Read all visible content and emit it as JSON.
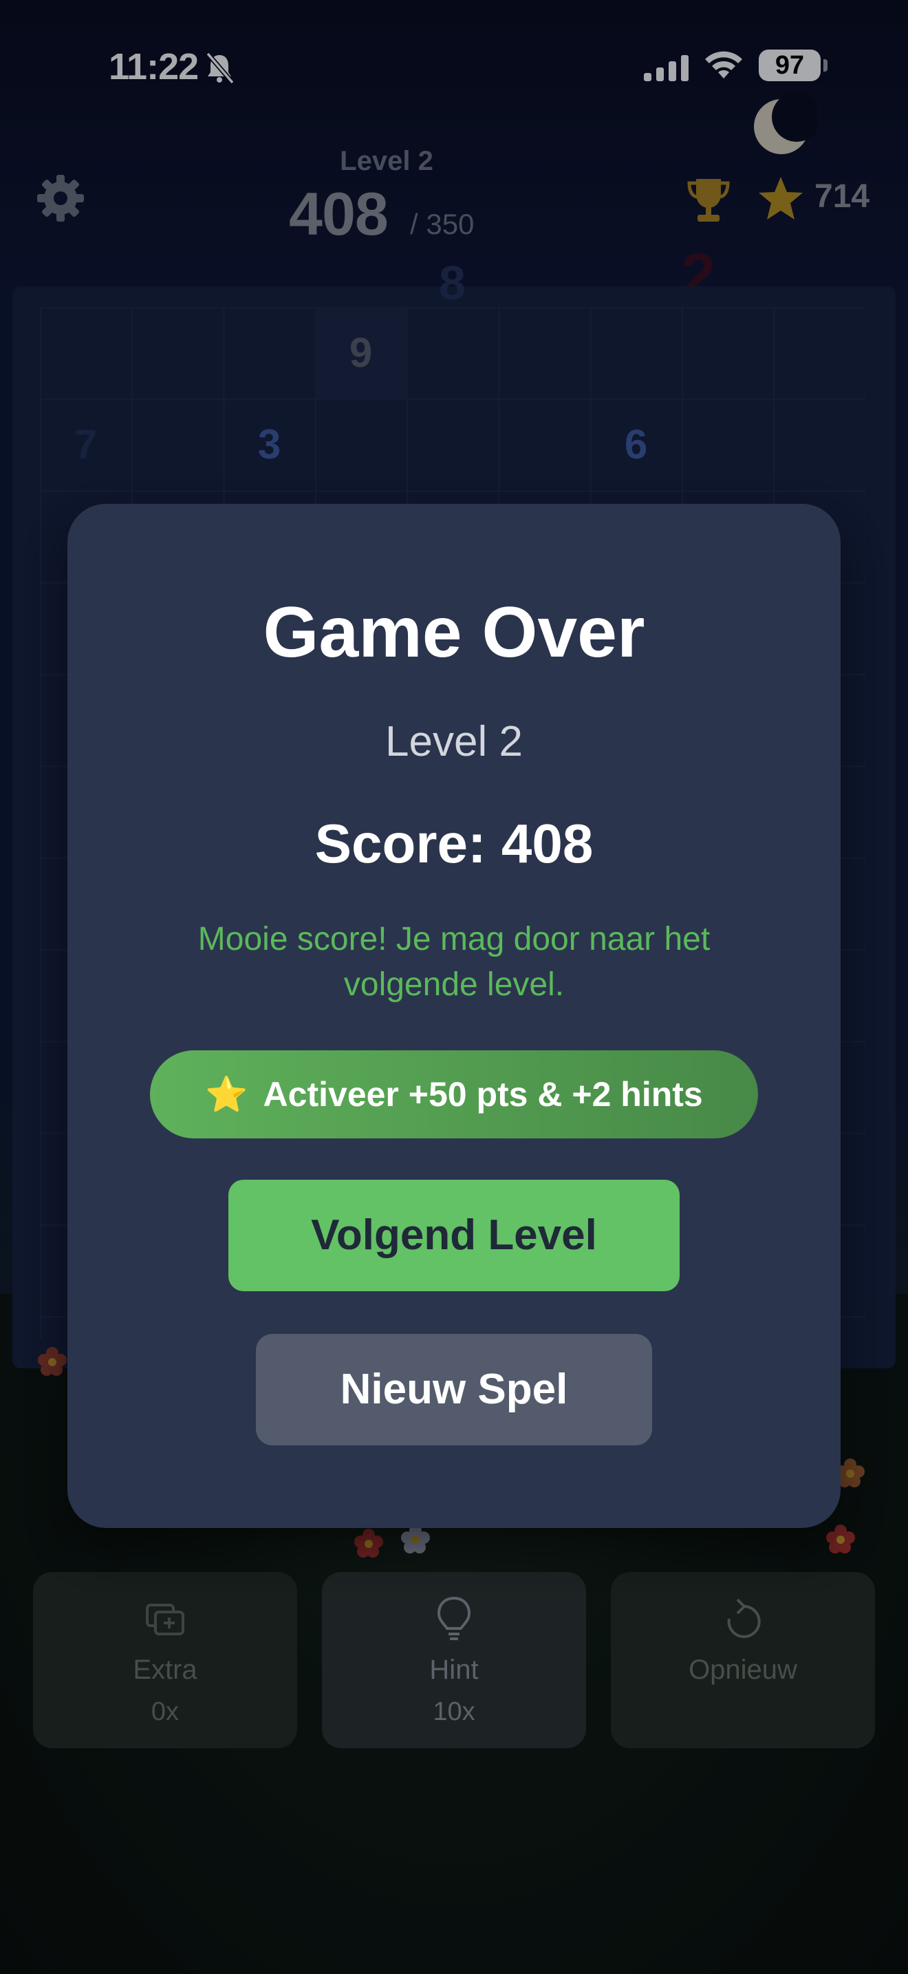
{
  "status_bar": {
    "time": "11:22",
    "battery": "97"
  },
  "header": {
    "level": "Level 2",
    "score": "408",
    "target": "/ 350",
    "stars": "714"
  },
  "board": {
    "cells": [
      {
        "value": "9",
        "style": "hi"
      },
      {
        "value": "3",
        "style": "blue"
      },
      {
        "value": "6",
        "style": "blue"
      },
      {
        "value": "7",
        "style": "dim"
      },
      {
        "value": "2",
        "style": "dim"
      },
      {
        "value": "7",
        "style": "dim"
      },
      {
        "value": "8",
        "style": "dim"
      }
    ]
  },
  "actions": {
    "extra": {
      "label": "Extra",
      "count": "0x"
    },
    "hint": {
      "label": "Hint",
      "count": "10x"
    },
    "restart": {
      "label": "Opnieuw"
    }
  },
  "modal": {
    "title": "Game Over",
    "level": "Level 2",
    "score": "Score: 408",
    "message": "Mooie score! Je mag door naar het volgende level.",
    "activate_icon": "⭐",
    "activate_label": "Activeer +50 pts & +2 hints",
    "next_label": "Volgend Level",
    "new_label": "Nieuw Spel"
  },
  "colors": {
    "accent_green": "#63c166",
    "modal_bg": "#2b344d",
    "message_green": "#5bb95b"
  },
  "icons": [
    "bell-slash-icon",
    "signal-icon",
    "wifi-icon",
    "gear-icon",
    "trophy-icon",
    "star-icon",
    "moon-icon",
    "extra-cards-icon",
    "lightbulb-icon",
    "restart-icon"
  ]
}
